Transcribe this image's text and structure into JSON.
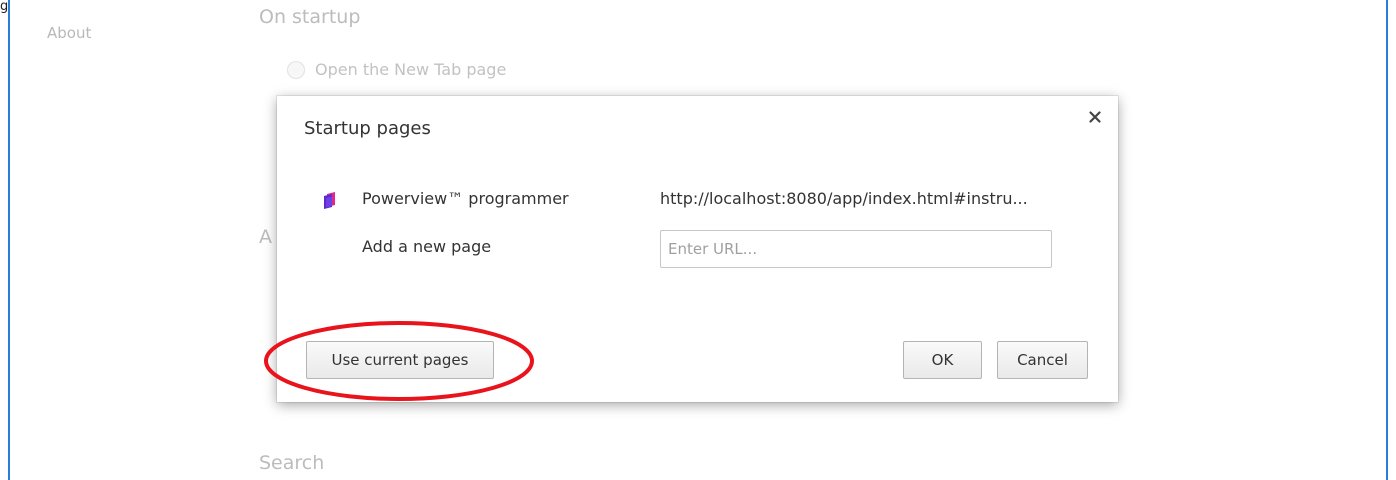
{
  "top_label": "g",
  "nav": {
    "about": "About"
  },
  "sections": {
    "on_startup": "On startup",
    "appearance": "A",
    "search": "Search"
  },
  "startup_option": {
    "label": "Open the New Tab page"
  },
  "dialog": {
    "title": "Startup pages",
    "close_label": "×",
    "pages": [
      {
        "name": "Powerview™ programmer",
        "url": "http://localhost:8080/app/index.html#instru..."
      }
    ],
    "add_page_label": "Add a new page",
    "url_placeholder": "Enter URL...",
    "url_value": "",
    "buttons": {
      "use_current": "Use current pages",
      "ok": "OK",
      "cancel": "Cancel"
    }
  },
  "colors": {
    "frame_border": "#2b7bd8",
    "annotation": "#e8131b",
    "favicon_primary": "#6a2fd6",
    "favicon_accent": "#e1278c"
  },
  "icons": {
    "close": "close-icon",
    "favicon": "powerview-favicon-icon"
  }
}
